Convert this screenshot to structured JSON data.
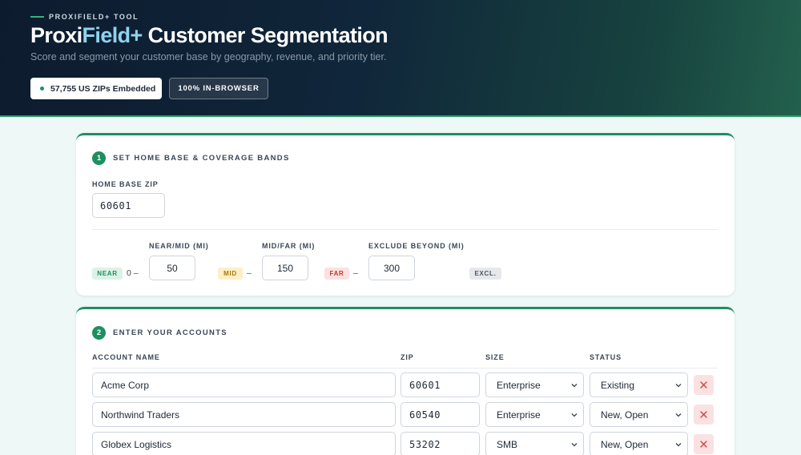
{
  "header": {
    "eyebrow": "PROXIFIELD+ TOOL",
    "title_part1": "Proxi",
    "title_part2": "Field+",
    "title_part3": " Customer Segmentation",
    "subtitle": "Score and segment your customer base by geography, revenue, and priority tier.",
    "badge_zips": "57,755 US ZIPs Embedded",
    "badge_browser": "100% IN-BROWSER"
  },
  "colors": {
    "accent_green": "#1e8f5e",
    "title_accent_blue": "#8fd3ee",
    "header_dark": "#0d1b2e"
  },
  "step1": {
    "number": "1",
    "title": "SET HOME BASE & COVERAGE BANDS",
    "home_zip_label": "HOME BASE ZIP",
    "home_zip_value": "60601",
    "near_mid_label": "NEAR/MID (MI)",
    "mid_far_label": "MID/FAR (MI)",
    "exclude_label": "EXCLUDE BEYOND (MI)",
    "near_tag": "NEAR",
    "near_start": "0 –",
    "near_mid_value": "50",
    "mid_tag": "MID",
    "mid_dash": "–",
    "mid_far_value": "150",
    "far_tag": "FAR",
    "far_dash": "–",
    "exclude_value": "300",
    "excl_tag": "EXCL."
  },
  "step2": {
    "number": "2",
    "title": "ENTER YOUR ACCOUNTS",
    "columns": {
      "account_name": "ACCOUNT NAME",
      "zip": "ZIP",
      "size": "SIZE",
      "status": "STATUS"
    },
    "rows": [
      {
        "name": "Acme Corp",
        "zip": "60601",
        "size": "Enterprise",
        "status": "Existing"
      },
      {
        "name": "Northwind Traders",
        "zip": "60540",
        "size": "Enterprise",
        "status": "New, Open"
      },
      {
        "name": "Globex Logistics",
        "zip": "53202",
        "size": "SMB",
        "status": "New, Open"
      }
    ]
  },
  "icons": {
    "select_arrow": "chevron-down-icon",
    "delete_row": "close-icon",
    "status_dot": "dot-icon"
  }
}
